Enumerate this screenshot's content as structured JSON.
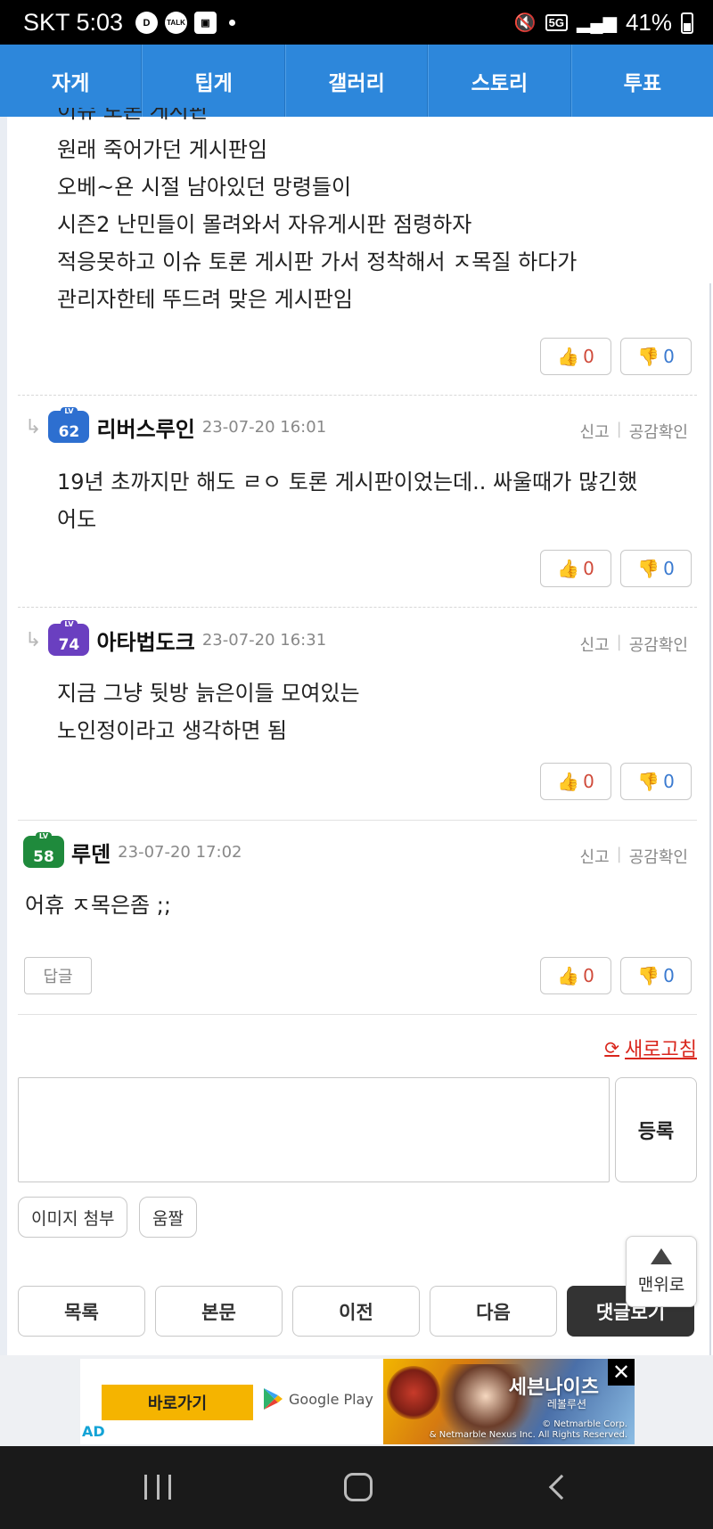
{
  "status_bar": {
    "carrier_time": "SKT 5:03",
    "icons": [
      "d-icon",
      "talk-icon",
      "twitch-icon"
    ],
    "talk_label": "TALK",
    "d_label": "D",
    "network": "5G",
    "battery": "41%"
  },
  "nav": {
    "tabs": [
      "자게",
      "팁게",
      "갤러리",
      "스토리",
      "투표"
    ]
  },
  "post": {
    "cut_line": "이슈 토론 게시판",
    "lines": [
      "원래 죽어가던 게시판임",
      "오베~욘 시절 남아있던 망령들이",
      "시즌2 난민들이 몰려와서 자유게시판 점령하자",
      "적응못하고 이슈 토론 게시판 가서 정착해서 ㅈ목질 하다가",
      "관리자한테 뚜드려 맞은 게시판임"
    ],
    "up": "0",
    "down": "0"
  },
  "comments": [
    {
      "level": "62",
      "lv_tag": "LV",
      "nick": "리버스루인",
      "date": "23-07-20 16:01",
      "report": "신고",
      "likes_check": "공감확인",
      "lines": [
        "19년 초까지만 해도 ㄹㅇ 토론 게시판이었는데.. 싸울때가 많긴했",
        "어도"
      ],
      "up": "0",
      "down": "0"
    },
    {
      "level": "74",
      "lv_tag": "LV",
      "nick": "아타법도크",
      "date": "23-07-20 16:31",
      "report": "신고",
      "likes_check": "공감확인",
      "lines": [
        "지금 그냥 뒷방 늙은이들 모여있는",
        "노인정이라고 생각하면 됨"
      ],
      "up": "0",
      "down": "0"
    },
    {
      "level": "58",
      "lv_tag": "LV",
      "nick": "루덴",
      "date": "23-07-20 17:02",
      "report": "신고",
      "likes_check": "공감확인",
      "lines": [
        "어휴 ㅈ목은좀 ;;"
      ],
      "reply_label": "답글",
      "up": "0",
      "down": "0"
    }
  ],
  "comment_form": {
    "refresh_label": "새로고침",
    "submit_label": "등록",
    "attach_image": "이미지 첨부",
    "emoticon": "움짤"
  },
  "bottom_nav": [
    "목록",
    "본문",
    "이전",
    "다음",
    "댓글보기"
  ],
  "scroll_top_label": "맨위로",
  "ad": {
    "cta": "바로가기",
    "store": "Google Play",
    "label": "AD",
    "title": "세븐나이츠",
    "subtitle": "레볼루션",
    "copyright_1": "© Netmarble Corp.",
    "copyright_2": "& Netmarble Nexus Inc. All Rights Reserved.",
    "close": "✕"
  },
  "colors": {
    "nav_blue": "#2d87db",
    "up_red": "#d04a3a",
    "down_blue": "#3a7ad0",
    "refresh_red": "#d9261c"
  }
}
